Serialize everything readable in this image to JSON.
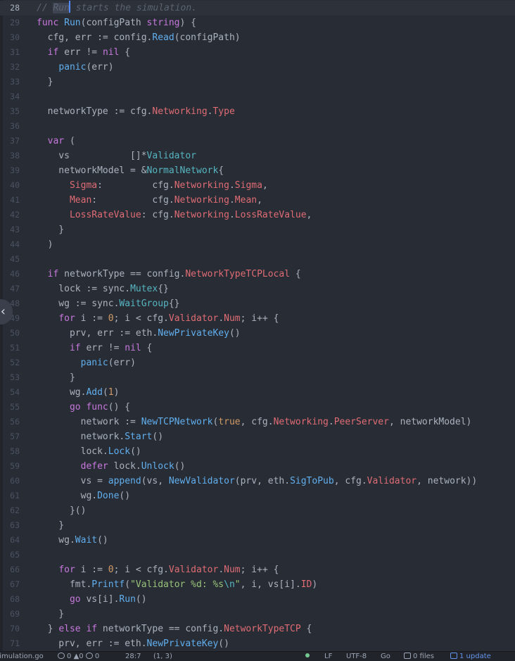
{
  "editor": {
    "first_line_number": 28,
    "active_line_number": 28,
    "lines": [
      [
        [
          "// ",
          "com"
        ],
        [
          "Run",
          "sel"
        ],
        [
          "|",
          "cursor"
        ],
        [
          " starts the simulation.",
          "com"
        ]
      ],
      [
        [
          "func",
          "kw"
        ],
        [
          " ",
          ""
        ],
        [
          "Run",
          "fn"
        ],
        [
          "(configPath ",
          ""
        ],
        [
          "string",
          "kw"
        ],
        [
          ") {",
          ""
        ]
      ],
      [
        [
          "  cfg, err := config.",
          ""
        ],
        [
          "Read",
          "fn"
        ],
        [
          "(configPath)",
          ""
        ]
      ],
      [
        [
          "  ",
          ""
        ],
        [
          "if",
          "kw"
        ],
        [
          " err != ",
          ""
        ],
        [
          "nil",
          "kw"
        ],
        [
          " {",
          ""
        ]
      ],
      [
        [
          "    ",
          ""
        ],
        [
          "panic",
          "fn"
        ],
        [
          "(err)",
          ""
        ]
      ],
      [
        [
          "  }",
          ""
        ]
      ],
      [],
      [
        [
          "  networkType := cfg.",
          ""
        ],
        [
          "Networking",
          "prop"
        ],
        [
          ".",
          ""
        ],
        [
          "Type",
          "prop"
        ]
      ],
      [],
      [
        [
          "  ",
          ""
        ],
        [
          "var",
          "kw"
        ],
        [
          " (",
          ""
        ]
      ],
      [
        [
          "    vs           []*",
          ""
        ],
        [
          "Validator",
          "type"
        ]
      ],
      [
        [
          "    networkModel = &",
          ""
        ],
        [
          "NormalNetwork",
          "type"
        ],
        [
          "{",
          ""
        ]
      ],
      [
        [
          "      ",
          ""
        ],
        [
          "Sigma",
          "prop"
        ],
        [
          ":         cfg.",
          ""
        ],
        [
          "Networking",
          "prop"
        ],
        [
          ".",
          ""
        ],
        [
          "Sigma",
          "prop"
        ],
        [
          ",",
          ""
        ]
      ],
      [
        [
          "      ",
          ""
        ],
        [
          "Mean",
          "prop"
        ],
        [
          ":          cfg.",
          ""
        ],
        [
          "Networking",
          "prop"
        ],
        [
          ".",
          ""
        ],
        [
          "Mean",
          "prop"
        ],
        [
          ",",
          ""
        ]
      ],
      [
        [
          "      ",
          ""
        ],
        [
          "LossRateValue",
          "prop"
        ],
        [
          ": cfg.",
          ""
        ],
        [
          "Networking",
          "prop"
        ],
        [
          ".",
          ""
        ],
        [
          "LossRateValue",
          "prop"
        ],
        [
          ",",
          ""
        ]
      ],
      [
        [
          "    }",
          ""
        ]
      ],
      [
        [
          "  )",
          ""
        ]
      ],
      [],
      [
        [
          "  ",
          ""
        ],
        [
          "if",
          "kw"
        ],
        [
          " networkType == config.",
          ""
        ],
        [
          "NetworkTypeTCPLocal",
          "prop"
        ],
        [
          " {",
          ""
        ]
      ],
      [
        [
          "    lock := sync.",
          ""
        ],
        [
          "Mutex",
          "type"
        ],
        [
          "{}",
          ""
        ]
      ],
      [
        [
          "    wg := sync.",
          ""
        ],
        [
          "WaitGroup",
          "type"
        ],
        [
          "{}",
          ""
        ]
      ],
      [
        [
          "    ",
          ""
        ],
        [
          "for",
          "kw"
        ],
        [
          " i := ",
          ""
        ],
        [
          "0",
          "num"
        ],
        [
          "; i < cfg.",
          ""
        ],
        [
          "Validator",
          "prop"
        ],
        [
          ".",
          ""
        ],
        [
          "Num",
          "prop"
        ],
        [
          "; i++ {",
          ""
        ]
      ],
      [
        [
          "      prv, err := eth.",
          ""
        ],
        [
          "NewPrivateKey",
          "fn"
        ],
        [
          "()",
          ""
        ]
      ],
      [
        [
          "      ",
          ""
        ],
        [
          "if",
          "kw"
        ],
        [
          " err != ",
          ""
        ],
        [
          "nil",
          "kw"
        ],
        [
          " {",
          ""
        ]
      ],
      [
        [
          "        ",
          ""
        ],
        [
          "panic",
          "fn"
        ],
        [
          "(err)",
          ""
        ]
      ],
      [
        [
          "      }",
          ""
        ]
      ],
      [
        [
          "      wg.",
          ""
        ],
        [
          "Add",
          "fn"
        ],
        [
          "(",
          ""
        ],
        [
          "1",
          "num"
        ],
        [
          ")",
          ""
        ]
      ],
      [
        [
          "      ",
          ""
        ],
        [
          "go",
          "kw"
        ],
        [
          " ",
          ""
        ],
        [
          "func",
          "kw"
        ],
        [
          "() {",
          ""
        ]
      ],
      [
        [
          "        network := ",
          ""
        ],
        [
          "NewTCPNetwork",
          "fn"
        ],
        [
          "(",
          ""
        ],
        [
          "true",
          "num"
        ],
        [
          ", cfg.",
          ""
        ],
        [
          "Networking",
          "prop"
        ],
        [
          ".",
          ""
        ],
        [
          "PeerServer",
          "prop"
        ],
        [
          ", networkModel)",
          ""
        ]
      ],
      [
        [
          "        network.",
          ""
        ],
        [
          "Start",
          "fn"
        ],
        [
          "()",
          ""
        ]
      ],
      [
        [
          "        lock.",
          ""
        ],
        [
          "Lock",
          "fn"
        ],
        [
          "()",
          ""
        ]
      ],
      [
        [
          "        ",
          ""
        ],
        [
          "defer",
          "kw"
        ],
        [
          " lock.",
          ""
        ],
        [
          "Unlock",
          "fn"
        ],
        [
          "()",
          ""
        ]
      ],
      [
        [
          "        vs = ",
          ""
        ],
        [
          "append",
          "fn"
        ],
        [
          "(vs, ",
          ""
        ],
        [
          "NewValidator",
          "fn"
        ],
        [
          "(prv, eth.",
          ""
        ],
        [
          "SigToPub",
          "fn"
        ],
        [
          ", cfg.",
          ""
        ],
        [
          "Validator",
          "prop"
        ],
        [
          ", network))",
          ""
        ]
      ],
      [
        [
          "        wg.",
          ""
        ],
        [
          "Done",
          "fn"
        ],
        [
          "()",
          ""
        ]
      ],
      [
        [
          "      }()",
          ""
        ]
      ],
      [
        [
          "    }",
          ""
        ]
      ],
      [
        [
          "    wg.",
          ""
        ],
        [
          "Wait",
          "fn"
        ],
        [
          "()",
          ""
        ]
      ],
      [],
      [
        [
          "    ",
          ""
        ],
        [
          "for",
          "kw"
        ],
        [
          " i := ",
          ""
        ],
        [
          "0",
          "num"
        ],
        [
          "; i < cfg.",
          ""
        ],
        [
          "Validator",
          "prop"
        ],
        [
          ".",
          ""
        ],
        [
          "Num",
          "prop"
        ],
        [
          "; i++ {",
          ""
        ]
      ],
      [
        [
          "      fmt.",
          ""
        ],
        [
          "Printf",
          "fn"
        ],
        [
          "(",
          ""
        ],
        [
          "\"Validator %d: %s",
          "str"
        ],
        [
          "\\n",
          "esc"
        ],
        [
          "\"",
          "str"
        ],
        [
          ", i, vs[i].",
          ""
        ],
        [
          "ID",
          "prop"
        ],
        [
          ")",
          ""
        ]
      ],
      [
        [
          "      ",
          ""
        ],
        [
          "go",
          "kw"
        ],
        [
          " vs[i].",
          ""
        ],
        [
          "Run",
          "fn"
        ],
        [
          "()",
          ""
        ]
      ],
      [
        [
          "    }",
          ""
        ]
      ],
      [
        [
          "  } ",
          ""
        ],
        [
          "else",
          "kw"
        ],
        [
          " ",
          ""
        ],
        [
          "if",
          "kw"
        ],
        [
          " networkType == config.",
          ""
        ],
        [
          "NetworkTypeTCP",
          "prop"
        ],
        [
          " {",
          ""
        ]
      ],
      [
        [
          "    prv, err := eth.",
          ""
        ],
        [
          "NewPrivateKey",
          "fn"
        ],
        [
          "()",
          ""
        ]
      ]
    ]
  },
  "collapse_glyph": "‹",
  "statusbar": {
    "file": "simulation.go",
    "errors": "0",
    "warnings": "0",
    "infos": "0",
    "cursor": "28:7",
    "selection": "(1, 3)",
    "line_ending": "LF",
    "encoding": "UTF-8",
    "grammar": "Go",
    "files": "0 files",
    "update": "1 update"
  }
}
